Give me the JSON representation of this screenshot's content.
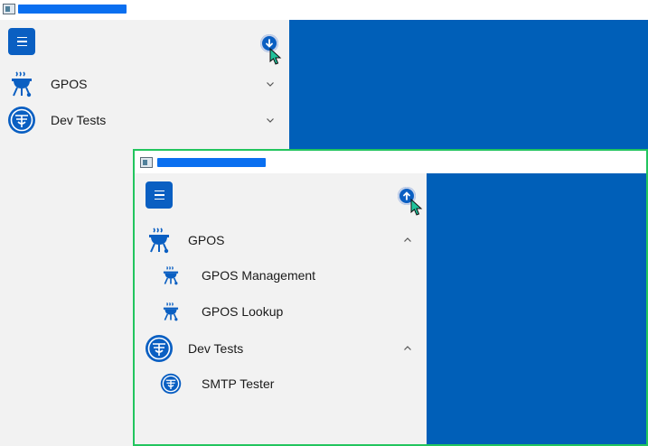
{
  "colors": {
    "accent": "#0a5fc2",
    "content_bg": "#005fb8",
    "pane_bg": "#f2f2f2",
    "highlight_border": "#22c55e"
  },
  "window_collapsed": {
    "nav": [
      {
        "label": "GPOS",
        "icon": "barbecue-grill-icon",
        "expanded": false
      },
      {
        "label": "Dev Tests",
        "icon": "shield-logo-icon",
        "expanded": false
      }
    ],
    "toggle_button": {
      "icon": "arrow-down-icon"
    }
  },
  "window_expanded": {
    "nav": [
      {
        "label": "GPOS",
        "icon": "barbecue-grill-icon",
        "expanded": true,
        "children": [
          {
            "label": "GPOS Management",
            "icon": "barbecue-grill-icon"
          },
          {
            "label": "GPOS Lookup",
            "icon": "barbecue-grill-icon"
          }
        ]
      },
      {
        "label": "Dev Tests",
        "icon": "shield-logo-icon",
        "expanded": true,
        "children": [
          {
            "label": "SMTP Tester",
            "icon": "shield-logo-icon"
          }
        ]
      }
    ],
    "toggle_button": {
      "icon": "arrow-up-icon"
    }
  }
}
